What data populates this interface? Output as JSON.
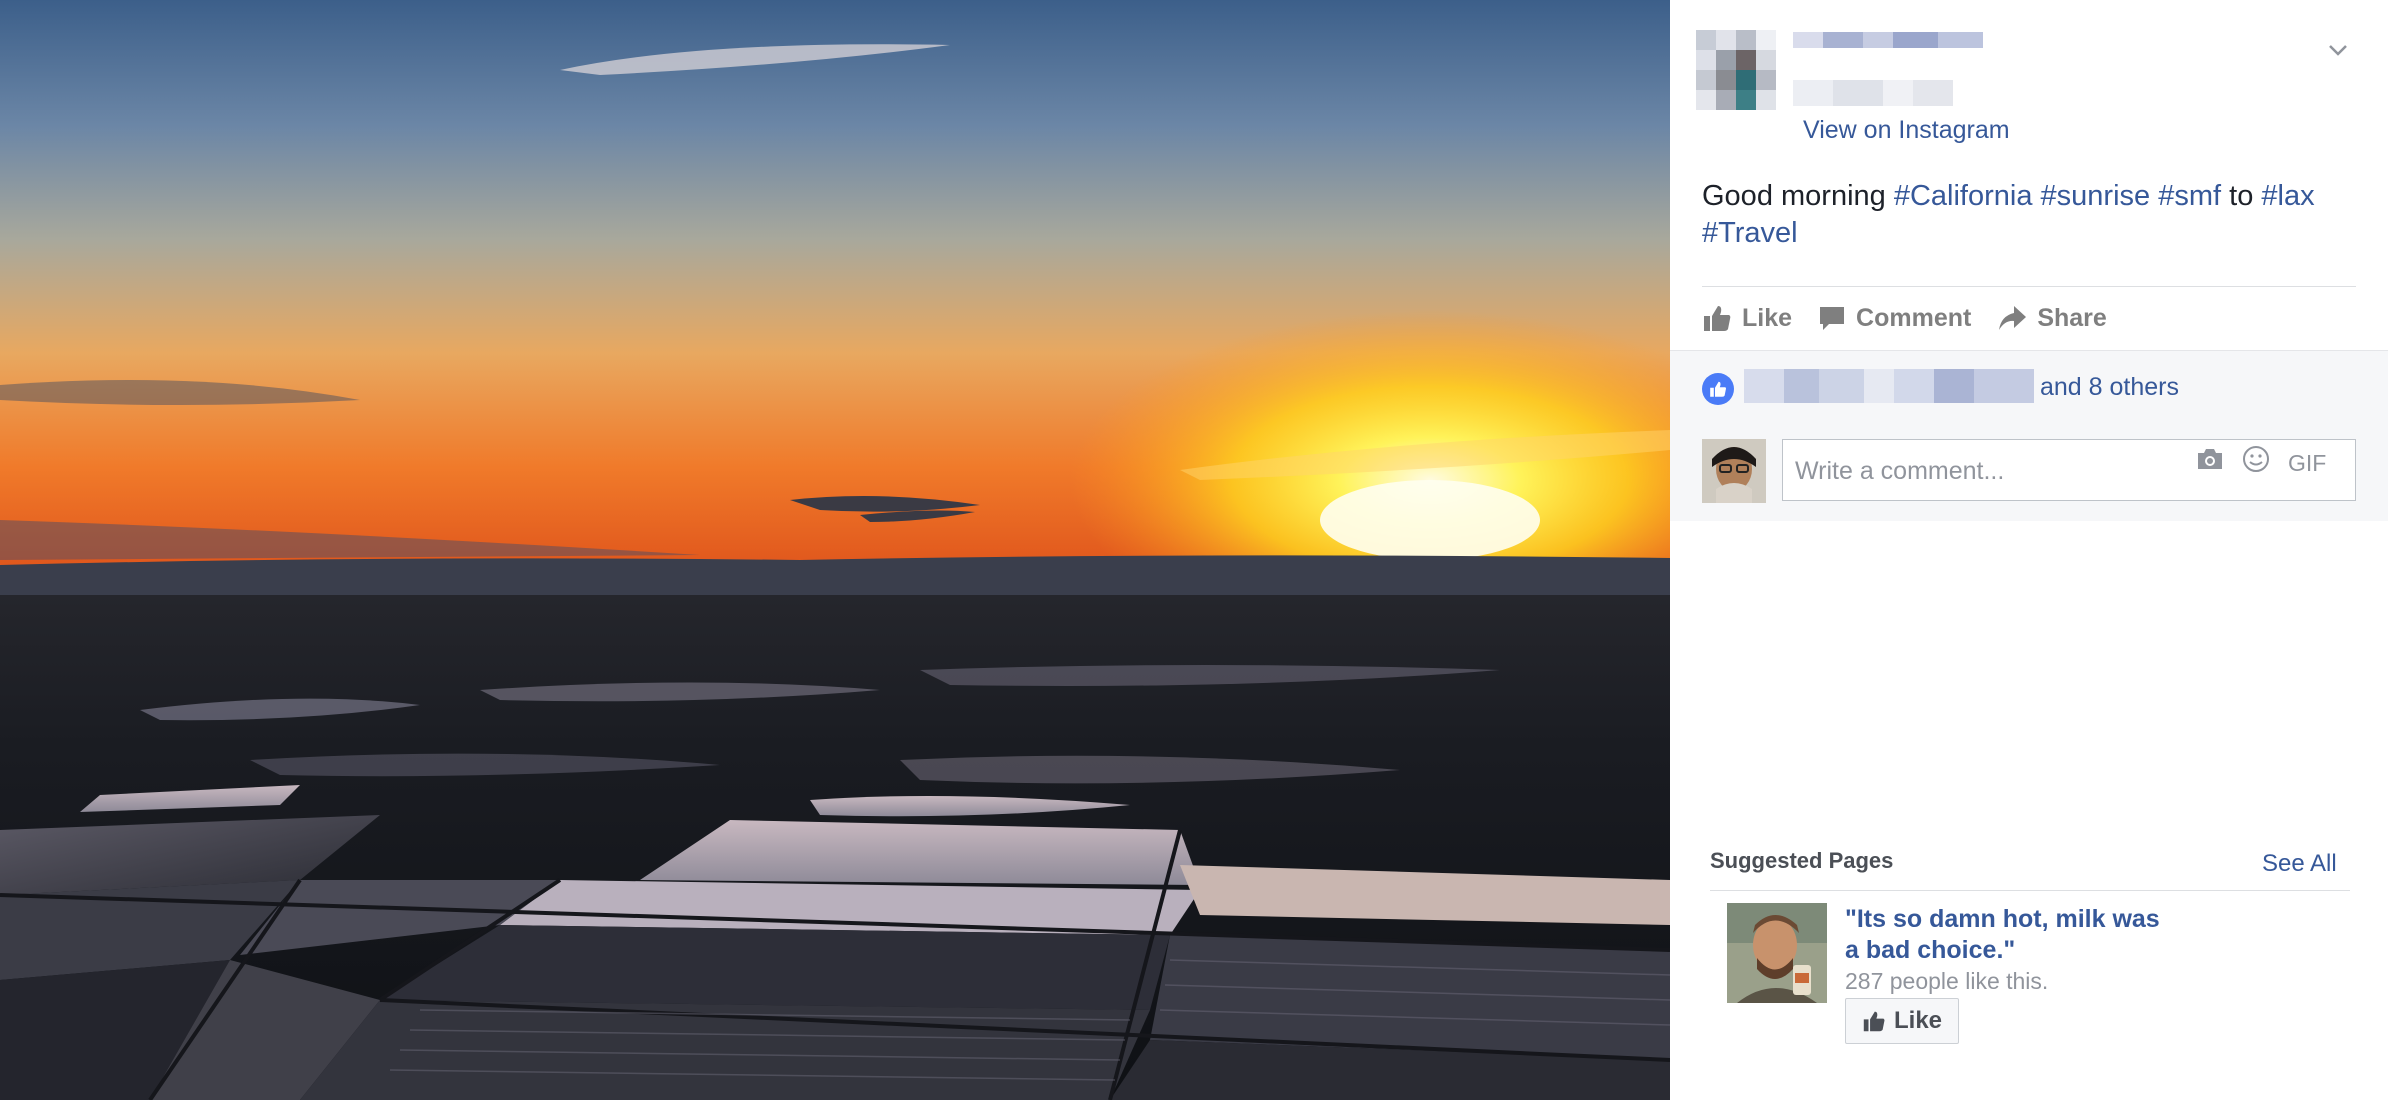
{
  "photo": {
    "alt": "Aerial sunrise over flooded fields"
  },
  "post": {
    "view_on_instagram": "View on Instagram",
    "caption_prefix": "Good morning",
    "hashtags": [
      "#California",
      "#sunrise",
      "#smf"
    ],
    "caption_mid": "to",
    "hashtags_2": [
      "#lax",
      "#Travel"
    ]
  },
  "actions": {
    "like": "Like",
    "comment": "Comment",
    "share": "Share"
  },
  "reactions": {
    "others_text": "and 8 others"
  },
  "comment_box": {
    "placeholder": "Write a comment...",
    "gif_label": "GIF"
  },
  "suggested": {
    "title": "Suggested Pages",
    "see_all": "See All",
    "page_name": "\"Its so damn hot, milk was a bad choice.\"",
    "likes_text": "287 people like this.",
    "like_button": "Like"
  },
  "colors": {
    "link": "#365899",
    "like_badge": "#4a7bf7",
    "muted": "#90949c"
  },
  "icons": [
    "chevron-down-icon",
    "thumbs-up-icon",
    "comment-icon",
    "share-icon",
    "camera-icon",
    "emoji-icon"
  ]
}
